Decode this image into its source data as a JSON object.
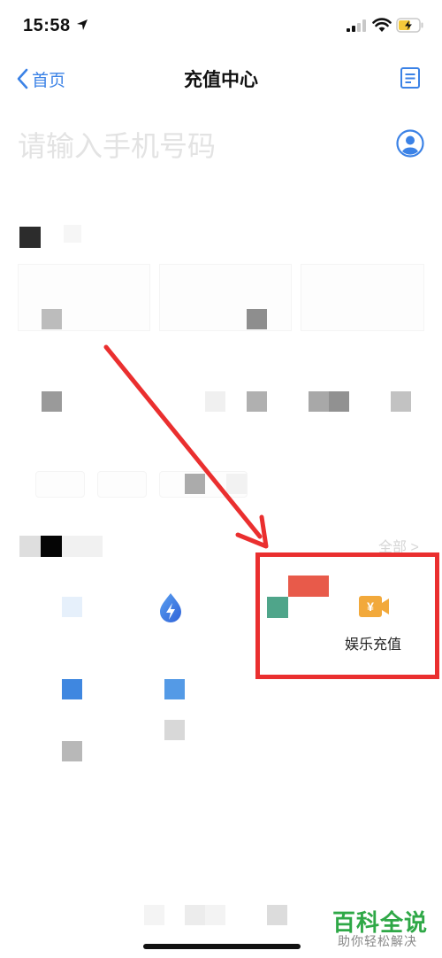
{
  "status_bar": {
    "time": "15:58"
  },
  "nav": {
    "back_label": "首页",
    "title": "充值中心"
  },
  "phone": {
    "placeholder": "请输入手机号码"
  },
  "section": {
    "more_label": "全部 >"
  },
  "services": {
    "entertainment_label": "娱乐充值",
    "currency_symbol": "¥"
  },
  "watermark": {
    "title": "百科全说",
    "subtitle": "助你轻松解决"
  },
  "colors": {
    "accent": "#3b82e6",
    "annotation": "#ea2f2f",
    "entertainment_icon": "#f2a93b",
    "watermark": "#2fa847"
  }
}
